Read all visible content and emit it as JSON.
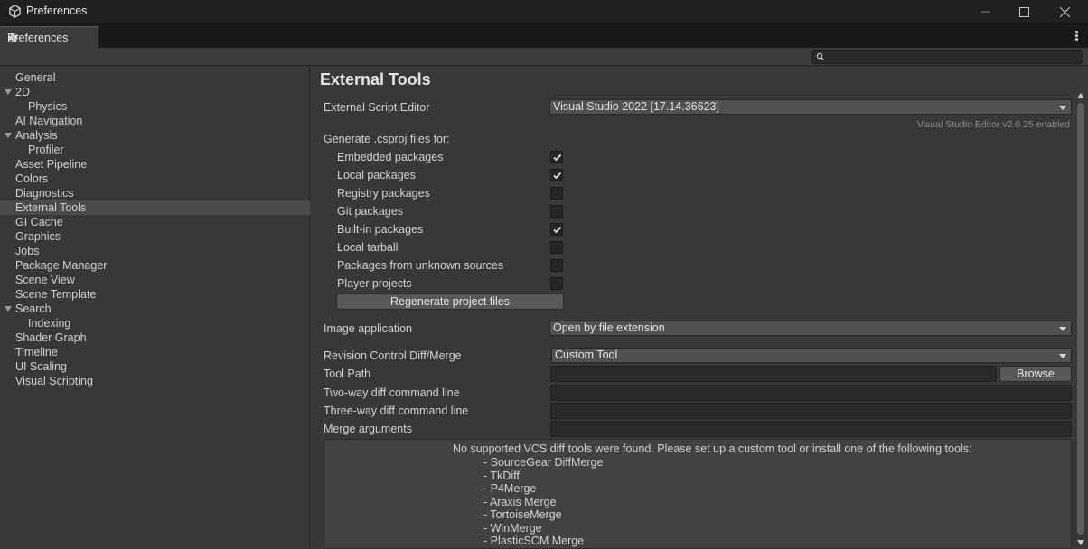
{
  "window": {
    "title": "Preferences",
    "icon": "unity-cube-icon",
    "controls": [
      "minimize-icon",
      "maximize-icon",
      "close-icon"
    ]
  },
  "tab": {
    "label": "Preferences",
    "icon": "gear-icon"
  },
  "toolbar": {
    "menu_icon": "kebab-menu-icon",
    "search_placeholder": "",
    "search_icon": "search-icon"
  },
  "sidebar": {
    "items": [
      {
        "label": "General",
        "indent": 0
      },
      {
        "label": "2D",
        "indent": 0,
        "expandable": true
      },
      {
        "label": "Physics",
        "indent": 1
      },
      {
        "label": "AI Navigation",
        "indent": 0
      },
      {
        "label": "Analysis",
        "indent": 0,
        "expandable": true
      },
      {
        "label": "Profiler",
        "indent": 1
      },
      {
        "label": "Asset Pipeline",
        "indent": 0
      },
      {
        "label": "Colors",
        "indent": 0
      },
      {
        "label": "Diagnostics",
        "indent": 0
      },
      {
        "label": "External Tools",
        "indent": 0,
        "selected": true
      },
      {
        "label": "GI Cache",
        "indent": 0
      },
      {
        "label": "Graphics",
        "indent": 0
      },
      {
        "label": "Jobs",
        "indent": 0
      },
      {
        "label": "Package Manager",
        "indent": 0
      },
      {
        "label": "Scene View",
        "indent": 0
      },
      {
        "label": "Scene Template",
        "indent": 0
      },
      {
        "label": "Search",
        "indent": 0,
        "expandable": true
      },
      {
        "label": "Indexing",
        "indent": 1
      },
      {
        "label": "Shader Graph",
        "indent": 0
      },
      {
        "label": "Timeline",
        "indent": 0
      },
      {
        "label": "UI Scaling",
        "indent": 0
      },
      {
        "label": "Visual Scripting",
        "indent": 0
      }
    ]
  },
  "main": {
    "heading": "External Tools",
    "script_editor": {
      "label": "External Script Editor",
      "value": "Visual Studio 2022 [17.14.36623]",
      "note": "Visual Studio Editor v2.0.25 enabled"
    },
    "csproj": {
      "label": "Generate .csproj files for:",
      "options": [
        {
          "label": "Embedded packages",
          "checked": true
        },
        {
          "label": "Local packages",
          "checked": true
        },
        {
          "label": "Registry packages",
          "checked": false
        },
        {
          "label": "Git packages",
          "checked": false
        },
        {
          "label": "Built-in packages",
          "checked": true
        },
        {
          "label": "Local tarball",
          "checked": false
        },
        {
          "label": "Packages from unknown sources",
          "checked": false
        },
        {
          "label": "Player projects",
          "checked": false
        }
      ],
      "regenerate_label": "Regenerate project files"
    },
    "image_application": {
      "label": "Image application",
      "value": "Open by file extension"
    },
    "revision_control": {
      "label": "Revision Control Diff/Merge",
      "value": "Custom Tool"
    },
    "tool_path": {
      "label": "Tool Path",
      "value": "",
      "browse_label": "Browse"
    },
    "two_way": {
      "label": "Two-way diff command line",
      "value": ""
    },
    "three_way": {
      "label": "Three-way diff command line",
      "value": ""
    },
    "merge_args": {
      "label": "Merge arguments",
      "value": ""
    },
    "message": {
      "intro": "No supported VCS diff tools were found. Please set up a custom tool or install one of the following tools:",
      "tools": [
        "- SourceGear DiffMerge",
        "- TkDiff",
        "- P4Merge",
        "- Araxis Merge",
        "- TortoiseMerge",
        "- WinMerge",
        "- PlasticSCM Merge"
      ]
    }
  },
  "colors": {
    "titlebar": "#202020",
    "panel": "#383838",
    "selected_row": "#4b4b4b",
    "field": "#2a2a2a",
    "dropdown": "#515151"
  }
}
